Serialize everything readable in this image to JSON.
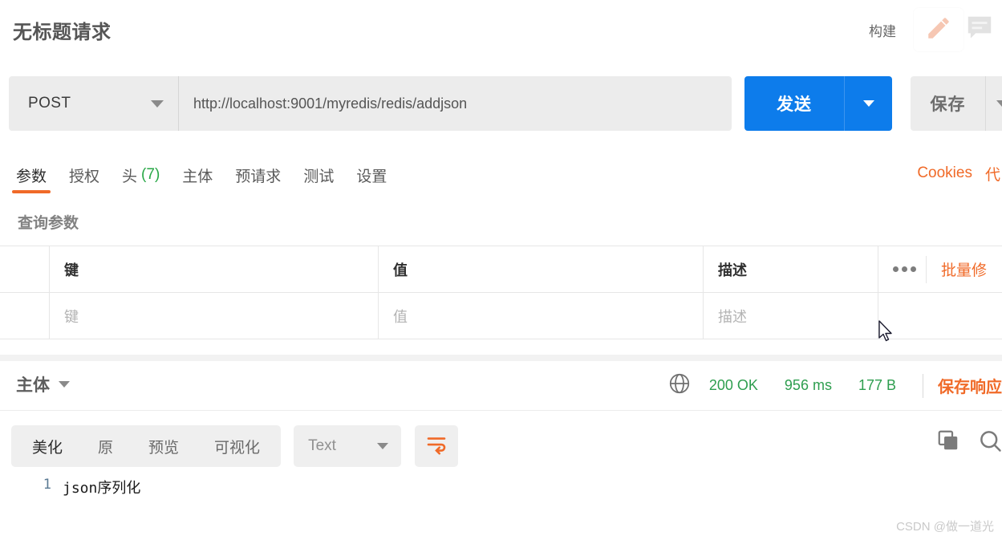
{
  "header": {
    "request_title": "无标题请求",
    "build_label": "构建",
    "edit_icon": "pencil-icon",
    "comment_icon": "comment-icon"
  },
  "urlbar": {
    "method": "POST",
    "method_caret_icon": "chevron-down-icon",
    "url": "http://localhost:9001/myredis/redis/addjson",
    "send_label": "发送",
    "send_caret_icon": "chevron-down-icon",
    "save_label": "保存",
    "save_caret_icon": "chevron-down-icon",
    "accent_blue": "#0d7ceb"
  },
  "tabs": {
    "items": [
      {
        "label": "参数",
        "count": ""
      },
      {
        "label": "授权",
        "count": ""
      },
      {
        "label": "头",
        "count": "(7)"
      },
      {
        "label": "主体",
        "count": ""
      },
      {
        "label": "预请求",
        "count": ""
      },
      {
        "label": "测试",
        "count": ""
      },
      {
        "label": "设置",
        "count": ""
      }
    ],
    "active_index": 0,
    "active_color": "#f06a28",
    "count_color": "#27a745",
    "right_links": [
      {
        "label": "Cookies"
      },
      {
        "label": "代"
      }
    ]
  },
  "params": {
    "section_title": "查询参数",
    "columns": [
      "键",
      "值",
      "描述"
    ],
    "placeholder_row": [
      "键",
      "值",
      "描述"
    ],
    "more_icon": "more-horizontal-icon",
    "bulk_edit_label": "批量修"
  },
  "response": {
    "body_label": "主体",
    "body_caret_icon": "chevron-down-icon",
    "globe_icon": "globe-icon",
    "status": "200 OK",
    "time": "956 ms",
    "size": "177 B",
    "save_response_label": "保存响应",
    "status_color": "#2e9e4f",
    "accent_orange": "#f06a28",
    "view_tabs": [
      {
        "label": "美化"
      },
      {
        "label": "原"
      },
      {
        "label": "预览"
      },
      {
        "label": "可视化"
      }
    ],
    "view_active_index": 0,
    "format_value": "Text",
    "format_caret_icon": "chevron-down-icon",
    "wrap_icon": "wrap-text-icon",
    "copy_icon": "copy-icon",
    "search_icon": "search-icon",
    "code_lines": [
      {
        "number": "1",
        "text": "json序列化"
      }
    ]
  },
  "watermark": "CSDN @做一道光"
}
